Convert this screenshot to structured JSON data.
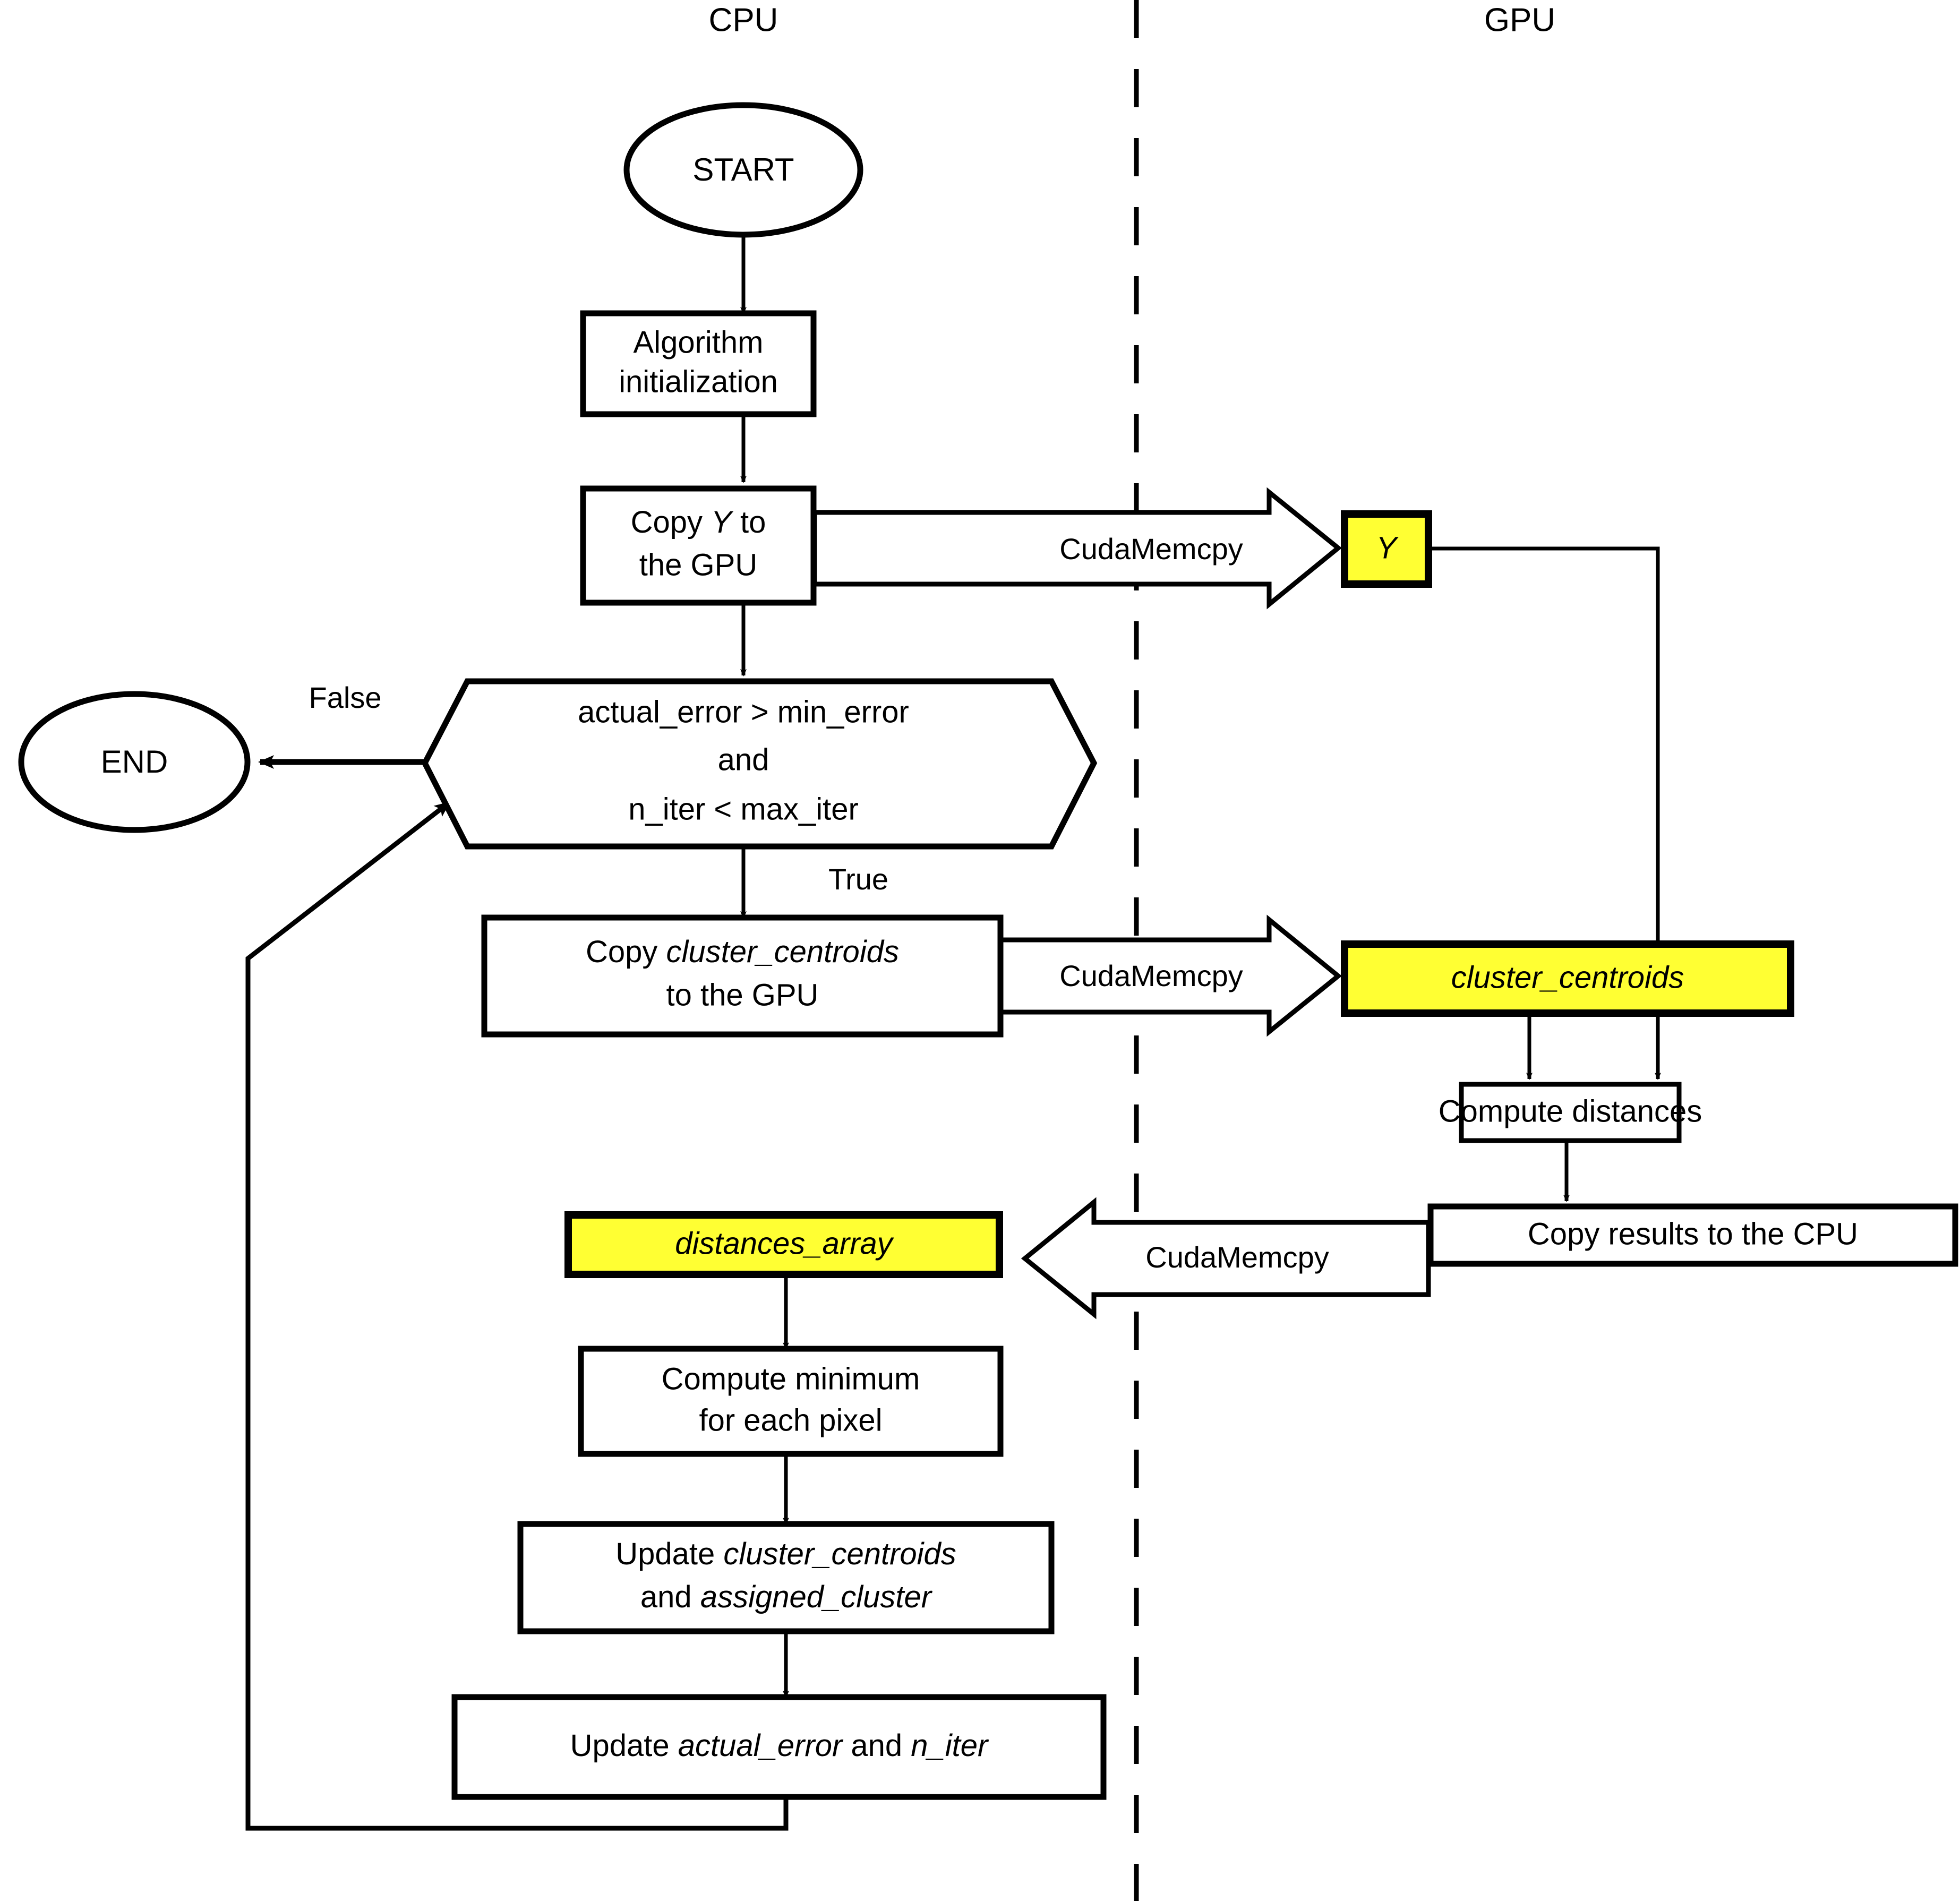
{
  "diagram": {
    "title_hidden": "",
    "lanes": [
      {
        "id": "cpu",
        "label": "CPU"
      },
      {
        "id": "gpu",
        "label": "GPU"
      }
    ],
    "colors": {
      "stroke": "#000000",
      "background": "#ffffff",
      "highlight_fill": "#ffff33",
      "node_fill": "#ffffff"
    },
    "nodes": [
      {
        "id": "start",
        "type": "terminator",
        "lane": "cpu",
        "label": "START"
      },
      {
        "id": "init",
        "type": "process",
        "lane": "cpu",
        "line1": "Algorithm",
        "line2": "initialization"
      },
      {
        "id": "copy_y",
        "type": "process",
        "lane": "cpu",
        "line1_a": "Copy ",
        "line1_em": "Y",
        "line1_b": " to",
        "line2": "the GPU"
      },
      {
        "id": "decision",
        "type": "hexagon",
        "lane": "cpu",
        "line1": "actual_error > min_error",
        "line2": "and",
        "line3": "n_iter < max_iter"
      },
      {
        "id": "end",
        "type": "terminator",
        "lane": "cpu",
        "label": "END"
      },
      {
        "id": "copy_cc",
        "type": "process",
        "lane": "cpu",
        "line1_a": "Copy ",
        "line1_em": "cluster_centroids",
        "line1_b": "",
        "line2": "to the GPU"
      },
      {
        "id": "y_data",
        "type": "data",
        "lane": "gpu",
        "label": "Y",
        "italic": true,
        "fill": "#ffff33"
      },
      {
        "id": "cc_data",
        "type": "data",
        "lane": "gpu",
        "label": "cluster_centroids",
        "italic": true,
        "fill": "#ffff33"
      },
      {
        "id": "compute_dist",
        "type": "process",
        "lane": "gpu",
        "label": "Compute distances"
      },
      {
        "id": "copy_res",
        "type": "process",
        "lane": "gpu",
        "label": "Copy results to the CPU"
      },
      {
        "id": "dist_arr",
        "type": "data",
        "lane": "cpu",
        "label": "distances_array",
        "italic": true,
        "fill": "#ffff33"
      },
      {
        "id": "min_pixel",
        "type": "process",
        "lane": "cpu",
        "line1": "Compute minimum",
        "line2": "for each pixel"
      },
      {
        "id": "update_cc",
        "type": "process",
        "lane": "cpu",
        "line1_a": "Update ",
        "line1_em": "cluster_centroids",
        "line2_a": "and ",
        "line2_em": "assigned_cluster"
      },
      {
        "id": "update_err",
        "type": "process",
        "lane": "cpu",
        "line1_a": "Update ",
        "line1_em": "actual_error",
        "line1_b": " and ",
        "line1_em2": "n_iter"
      }
    ],
    "edges": [
      {
        "from": "start",
        "to": "init",
        "label": ""
      },
      {
        "from": "init",
        "to": "copy_y",
        "label": ""
      },
      {
        "from": "copy_y",
        "to": "y_data",
        "label": "CudaMemcpy",
        "style": "block-arrow"
      },
      {
        "from": "copy_y",
        "to": "decision",
        "label": ""
      },
      {
        "from": "decision",
        "to": "end",
        "label": "False"
      },
      {
        "from": "decision",
        "to": "copy_cc",
        "label": "True"
      },
      {
        "from": "copy_cc",
        "to": "cc_data",
        "label": "CudaMemcpy",
        "style": "block-arrow"
      },
      {
        "from": "cc_data",
        "to": "compute_dist",
        "label": ""
      },
      {
        "from": "y_data",
        "to": "compute_dist",
        "label": ""
      },
      {
        "from": "compute_dist",
        "to": "copy_res",
        "label": ""
      },
      {
        "from": "copy_res",
        "to": "dist_arr",
        "label": "CudaMemcpy",
        "style": "block-arrow"
      },
      {
        "from": "dist_arr",
        "to": "min_pixel",
        "label": ""
      },
      {
        "from": "min_pixel",
        "to": "update_cc",
        "label": ""
      },
      {
        "from": "update_cc",
        "to": "update_err",
        "label": ""
      },
      {
        "from": "update_err",
        "to": "decision",
        "label": ""
      }
    ],
    "edge_labels": {
      "cuda_memcpy_1": "CudaMemcpy",
      "cuda_memcpy_2": "CudaMemcpy",
      "cuda_memcpy_3": "CudaMemcpy",
      "decision_false": "False",
      "decision_true": "True"
    },
    "divider": {
      "type": "dashed-vertical",
      "label": "cpu-gpu-boundary"
    }
  }
}
